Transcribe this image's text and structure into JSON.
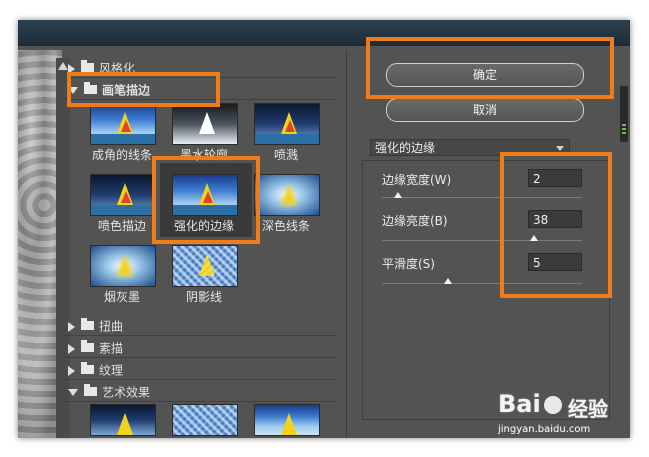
{
  "gallery": {
    "categories": [
      {
        "label": "风格化",
        "expanded": false
      },
      {
        "label": "画笔描边",
        "expanded": true
      },
      {
        "label": "扭曲",
        "expanded": false
      },
      {
        "label": "素描",
        "expanded": false
      },
      {
        "label": "纹理",
        "expanded": false
      },
      {
        "label": "艺术效果",
        "expanded": true
      }
    ],
    "brush_filters": [
      "成角的线条",
      "墨水轮廓",
      "喷溅",
      "喷色描边",
      "强化的边缘",
      "深色线条",
      "烟灰墨",
      "阴影线"
    ],
    "selected_filter": "强化的边缘"
  },
  "buttons": {
    "ok": "确定",
    "cancel": "取消"
  },
  "filter_select": {
    "value": "强化的边缘"
  },
  "params": [
    {
      "label": "边缘宽度(W)",
      "value": "2",
      "fraction": 0.08
    },
    {
      "label": "边缘亮度(B)",
      "value": "38",
      "fraction": 0.76
    },
    {
      "label": "平滑度(S)",
      "value": "5",
      "fraction": 0.33
    }
  ],
  "watermark": {
    "logo": "Bai",
    "logo2": "经验",
    "url": "jingyan.baidu.com"
  },
  "colors": {
    "highlight": "#f07b18",
    "panel": "#535353"
  }
}
